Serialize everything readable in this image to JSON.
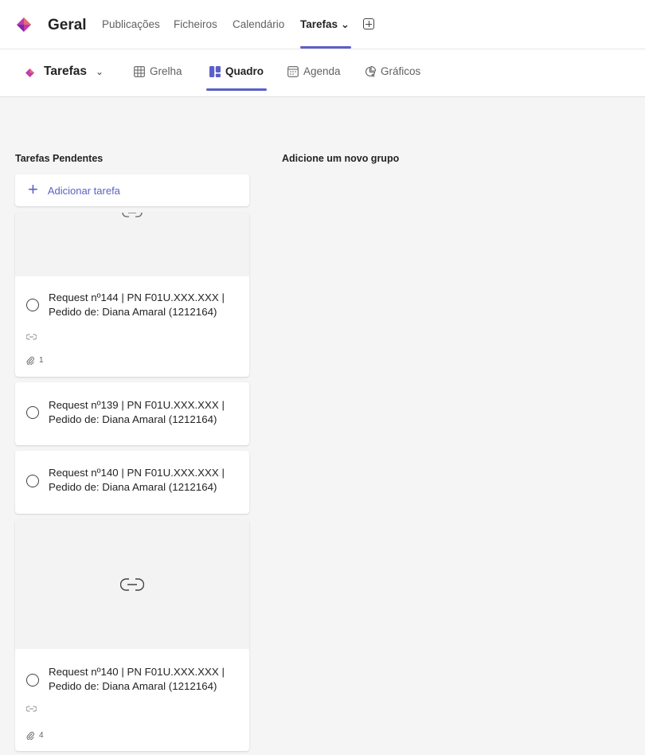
{
  "header": {
    "channel_name": "Geral",
    "tabs": [
      {
        "label": "Publicações"
      },
      {
        "label": "Ficheiros"
      },
      {
        "label": "Calendário"
      },
      {
        "label": "Tarefas ⌄"
      }
    ]
  },
  "viewbar": {
    "title": "Tarefas",
    "views": [
      {
        "label": "Grelha"
      },
      {
        "label": "Quadro"
      },
      {
        "label": "Agenda"
      },
      {
        "label": "Gráficos"
      }
    ]
  },
  "board": {
    "bucket_name": "Tarefas Pendentes",
    "add_group_label": "Adicione um novo grupo",
    "add_task_label": "Adicionar tarefa",
    "cards": [
      {
        "title_line1": "Request nº144 | PN F01U.XXX.XXX |",
        "title_line2": "Pedido de: Diana Amaral (1212164)",
        "attachments": "1"
      },
      {
        "title_line1": "Request nº139 | PN F01U.XXX.XXX |",
        "title_line2": "Pedido de: Diana Amaral (1212164)"
      },
      {
        "title_line1": "Request nº140 | PN F01U.XXX.XXX |",
        "title_line2": "Pedido de: Diana Amaral (1212164)"
      },
      {
        "title_line1": "Request nº140 | PN F01U.XXX.XXX |",
        "title_line2": "Pedido de: Diana Amaral (1212164)",
        "attachments": "4"
      }
    ]
  },
  "colors": {
    "accent": "#5b5fc7",
    "planner_brand": "#c239b3"
  }
}
